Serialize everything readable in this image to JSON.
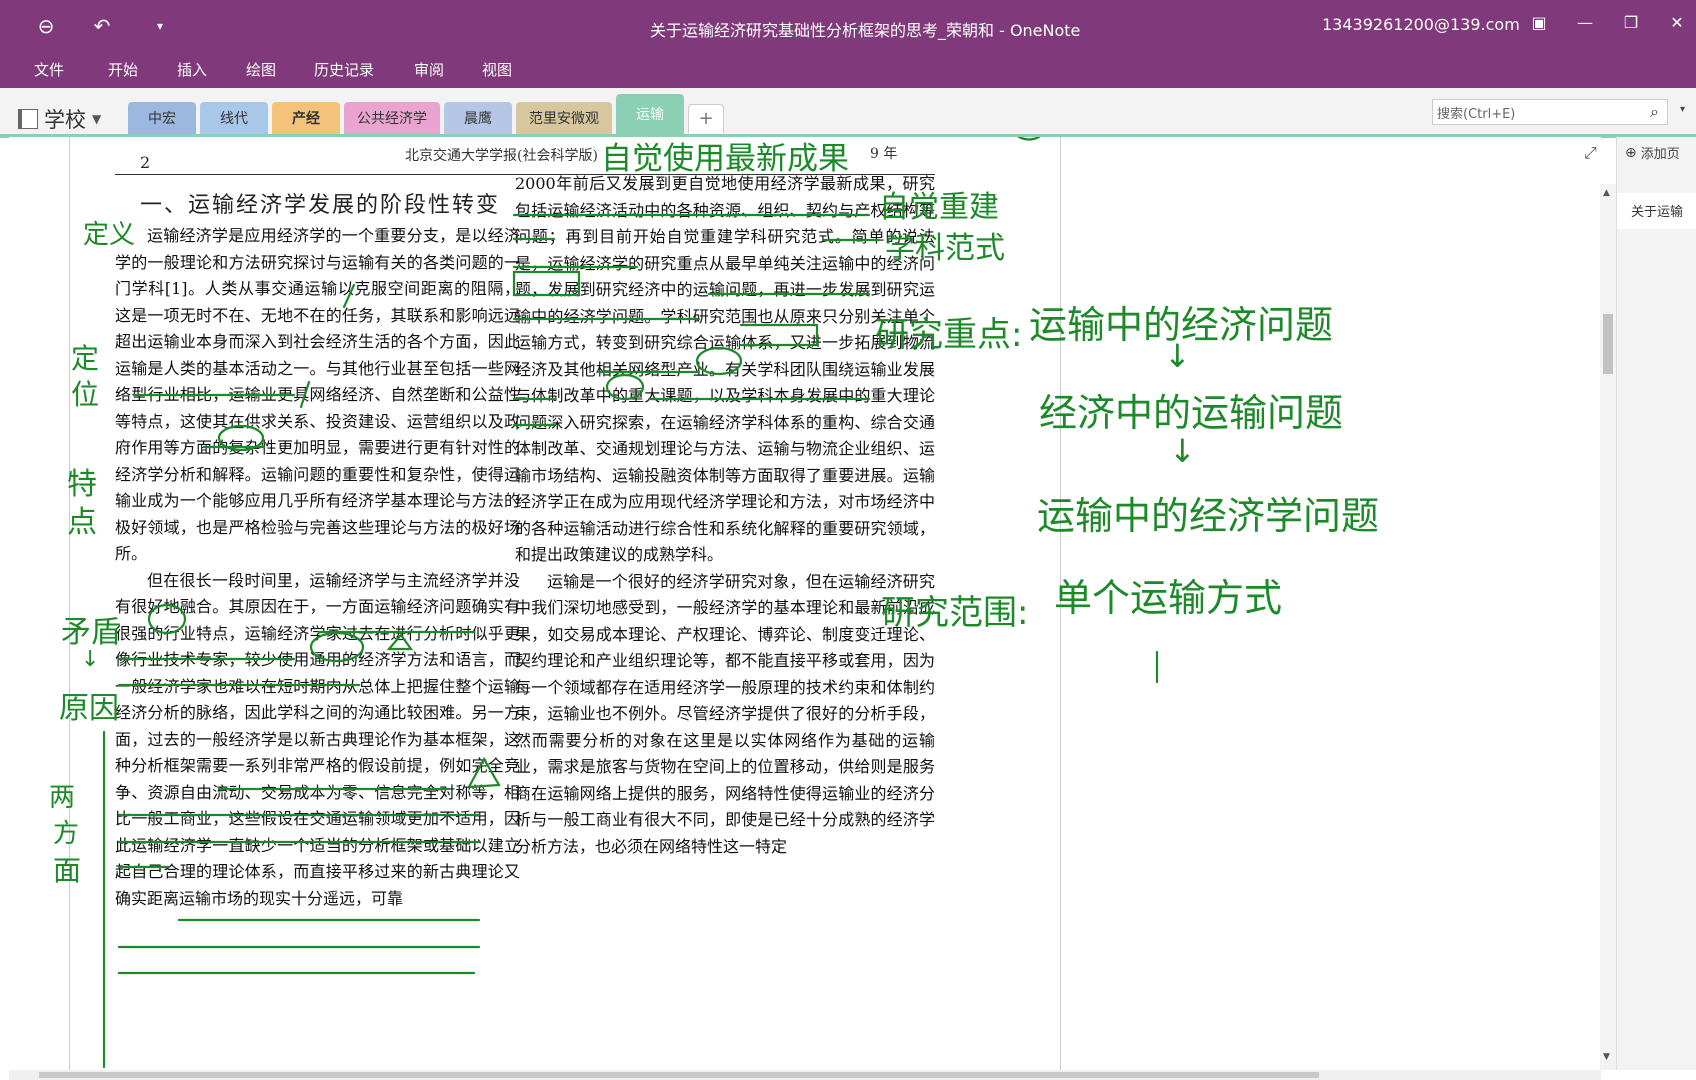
{
  "window": {
    "title": "关于运输经济研究基础性分析框架的思考_荣朝和  -  OneNote",
    "account": "13439261200@139.com",
    "back_icon": "back-arrow-icon",
    "undo_icon": "undo-icon"
  },
  "menu": [
    "文件",
    "开始",
    "插入",
    "绘图",
    "历史记录",
    "审阅",
    "视图"
  ],
  "notebook": {
    "name": "学校"
  },
  "sections": [
    {
      "label": "中宏",
      "color": "#9DB8E0"
    },
    {
      "label": "线代",
      "color": "#A9C7E9"
    },
    {
      "label": "产经",
      "color": "#F4C27A"
    },
    {
      "label": "公共经济学",
      "color": "#E9A5D0"
    },
    {
      "label": "晨鹰",
      "color": "#B6C7E6"
    },
    {
      "label": "范里安微观",
      "color": "#D7C79E"
    },
    {
      "label": "运输",
      "color": "#8BD0B4",
      "active": true
    }
  ],
  "add_section": "+",
  "search": {
    "placeholder": "搜索(Ctrl+E)"
  },
  "pages_pane": {
    "add_page": "添加页",
    "pages": [
      "关于运输"
    ]
  },
  "document": {
    "page_number": "2",
    "journal": "北京交通大学学报(社会科学版)",
    "year_suffix": "9 年",
    "section_title": "一、运输经济学发展的阶段性转变",
    "col1_paragraphs": [
      "运输经济学是应用经济学的一个重要分支，是以经济学的一般理论和方法研究探讨与运输有关的各类问题的一门学科[1]。人类从事交通运输以克服空间距离的阻隔，这是一项无时不在、无地不在的任务，其联系和影响远远超出运输业本身而深入到社会经济生活的各个方面，因此运输是人类的基本活动之一。与其他行业甚至包括一些网络型行业相比，运输业更具网络经济、自然垄断和公益性等特点，这使其在供求关系、投资建设、运营组织以及政府作用等方面的复杂性更加明显，需要进行更有针对性的经济学分析和解释。运输问题的重要性和复杂性，使得运输业成为一个能够应用几乎所有经济学基本理论与方法的极好领域，也是严格检验与完善这些理论与方法的极好场所。",
      "但在很长一段时间里，运输经济学与主流经济学并没有很好地融合。其原因在于，一方面运输经济问题确实有很强的行业特点，运输经济学家过去在进行分析时似乎更像行业技术专家，较少使用通用的经济学方法和语言，而一般经济学家也难以在短时期内从总体上把握住整个运输经济分析的脉络，因此学科之间的沟通比较困难。另一方面，过去的一般经济学是以新古典理论作为基本框架，这种分析框架需要一系列非常严格的假设前提，例如完全竞争、资源自由流动、交易成本为零、信息完全对称等，相比一般工商业，这些假设在交通运输领域更加不适用，因此运输经济学一直缺少一个适当的分析框架或基础以建立起自己合理的理论体系，而直接平移过来的新古典理论又确实距离运输市场的现实十分遥远，可靠"
    ],
    "col2_paragraphs": [
      "2000年前后又发展到更自觉地使用经济学最新成果，研究包括运输经济活动中的各种资源、组织、契约与产权结构等问题；再到目前开始自觉重建学科研究范式。简单的说法是，运输经济学的研究重点从最早单纯关注运输中的经济问题，发展到研究经济中的运输问题，再进一步发展到研究运输中的经济学问题。学科研究范围也从原来只分别关注单个运输方式，转变到研究综合运输体系，又进一步拓展到物流经济及其他相关网络型产业。有关学科团队围绕运输业发展与体制改革中的重大课题，以及学科本身发展中的重大理论问题深入研究探索，在运输经济学科体系的重构、综合交通体制改革、交通规划理论与方法、运输与物流企业组织、运输市场结构、运输投融资体制等方面取得了重要进展。运输经济学正在成为应用现代经济学理论和方法，对市场经济中的各种运输活动进行综合性和系统化解释的重要研究领域，和提出政策建议的成熟学科。",
      "运输是一个很好的经济学研究对象，但在运输经济研究中我们深切地感受到，一般经济学的基本理论和最新前沿成果，如交易成本理论、产权理论、博弈论、制度变迁理论、契约理论和产业组织理论等，都不能直接平移或套用，因为每一个领域都存在适用经济学一般原理的技术约束和体制约束，运输业也不例外。尽管经济学提供了很好的分析手段，然而需要分析的对象在这里是以实体网络作为基础的运输业，需求是旅客与货物在空间上的位置移动，供给则是服务商在运输网络上提供的服务，网络特性使得运输业的经济分析与一般工商业有很大不同，即使是已经十分成熟的经济学分析方法，也必须在网络特性这一特定"
    ]
  },
  "handwriting": {
    "top_note": "自觉使用最新成果",
    "rebuild_1": "自觉重建",
    "rebuild_2": "学科范式",
    "focus_label": "研究重点:",
    "focus_1": "运输中的经济问题",
    "arrow_1": "↓",
    "focus_2": "经济中的运输问题",
    "arrow_2": "↓",
    "focus_3": "运输中的经济学问题",
    "scope_label": "研究范围:",
    "scope_1": "单个运输方式",
    "margin_define": "定义",
    "margin_position_1": "定",
    "margin_position_2": "位",
    "margin_feature_1": "特",
    "margin_feature_2": "点",
    "margin_contra": "矛盾",
    "margin_arrow": "↓",
    "margin_reason": "原因",
    "margin_two_1": "两",
    "margin_two_2": "方",
    "margin_two_3": "面",
    "ink_color": "#1d8a2a"
  }
}
